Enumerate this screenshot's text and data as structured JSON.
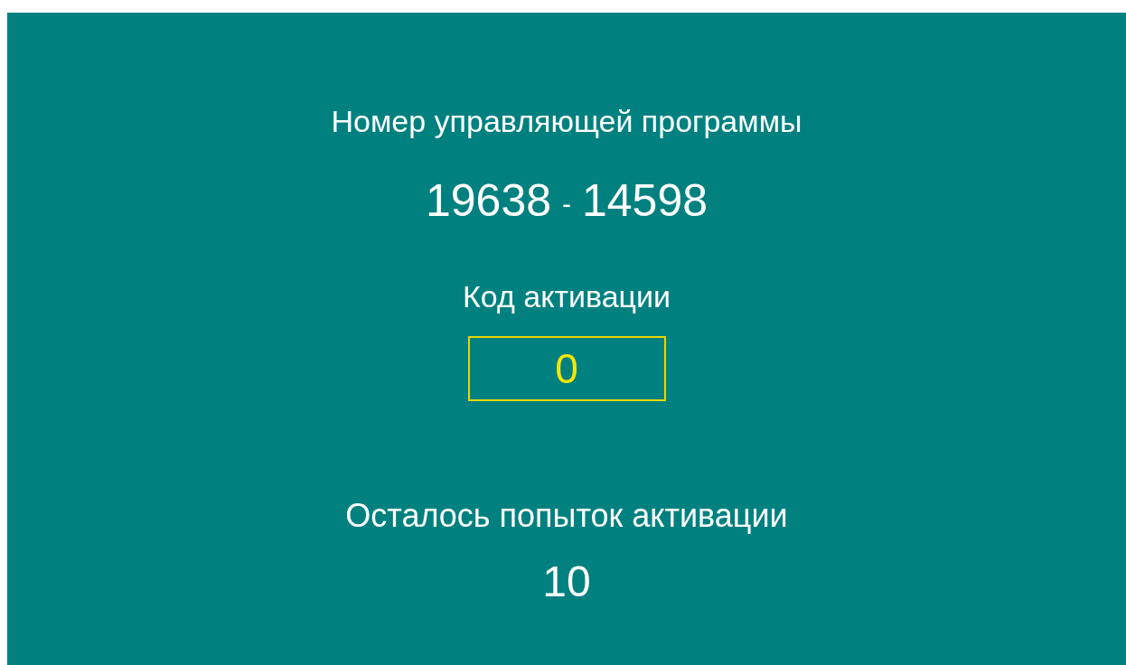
{
  "program_number": {
    "label": "Номер управляющей программы",
    "first": "19638",
    "separator": "-",
    "second": "14598"
  },
  "activation_code": {
    "label": "Код активации",
    "value": "0"
  },
  "attempts": {
    "label": "Осталось попыток активации",
    "value": "10"
  }
}
